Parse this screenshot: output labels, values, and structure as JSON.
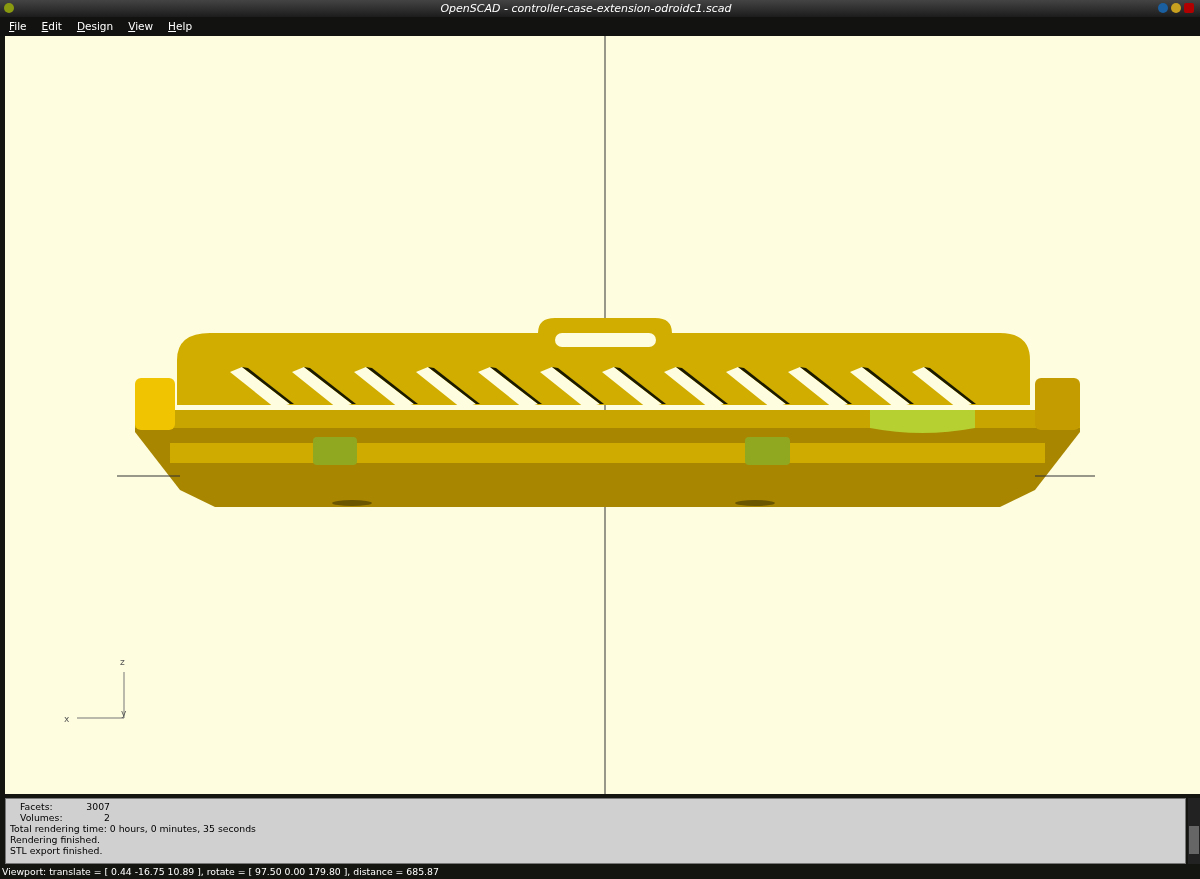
{
  "window": {
    "title": "OpenSCAD - controller-case-extension-odroidc1.scad"
  },
  "menu": [
    {
      "label": "File"
    },
    {
      "label": "Edit"
    },
    {
      "label": "Design"
    },
    {
      "label": "View"
    },
    {
      "label": "Help"
    }
  ],
  "viewport": {
    "axis_labels": {
      "z": "z",
      "x": "x",
      "y": "y"
    }
  },
  "console": {
    "lines": [
      {
        "kind": "stat",
        "label": "Facets:",
        "value": "3007"
      },
      {
        "kind": "stat",
        "label": "Volumes:",
        "value": "2"
      },
      {
        "kind": "text",
        "text": "Total rendering time: 0 hours, 0 minutes, 35 seconds"
      },
      {
        "kind": "text",
        "text": "Rendering finished."
      },
      {
        "kind": "text",
        "text": "STL export finished."
      }
    ]
  },
  "status_bar": "Viewport: translate = [ 0.44 -16.75 10.89 ], rotate = [ 97.50 0.00 179.80 ], distance = 685.87"
}
